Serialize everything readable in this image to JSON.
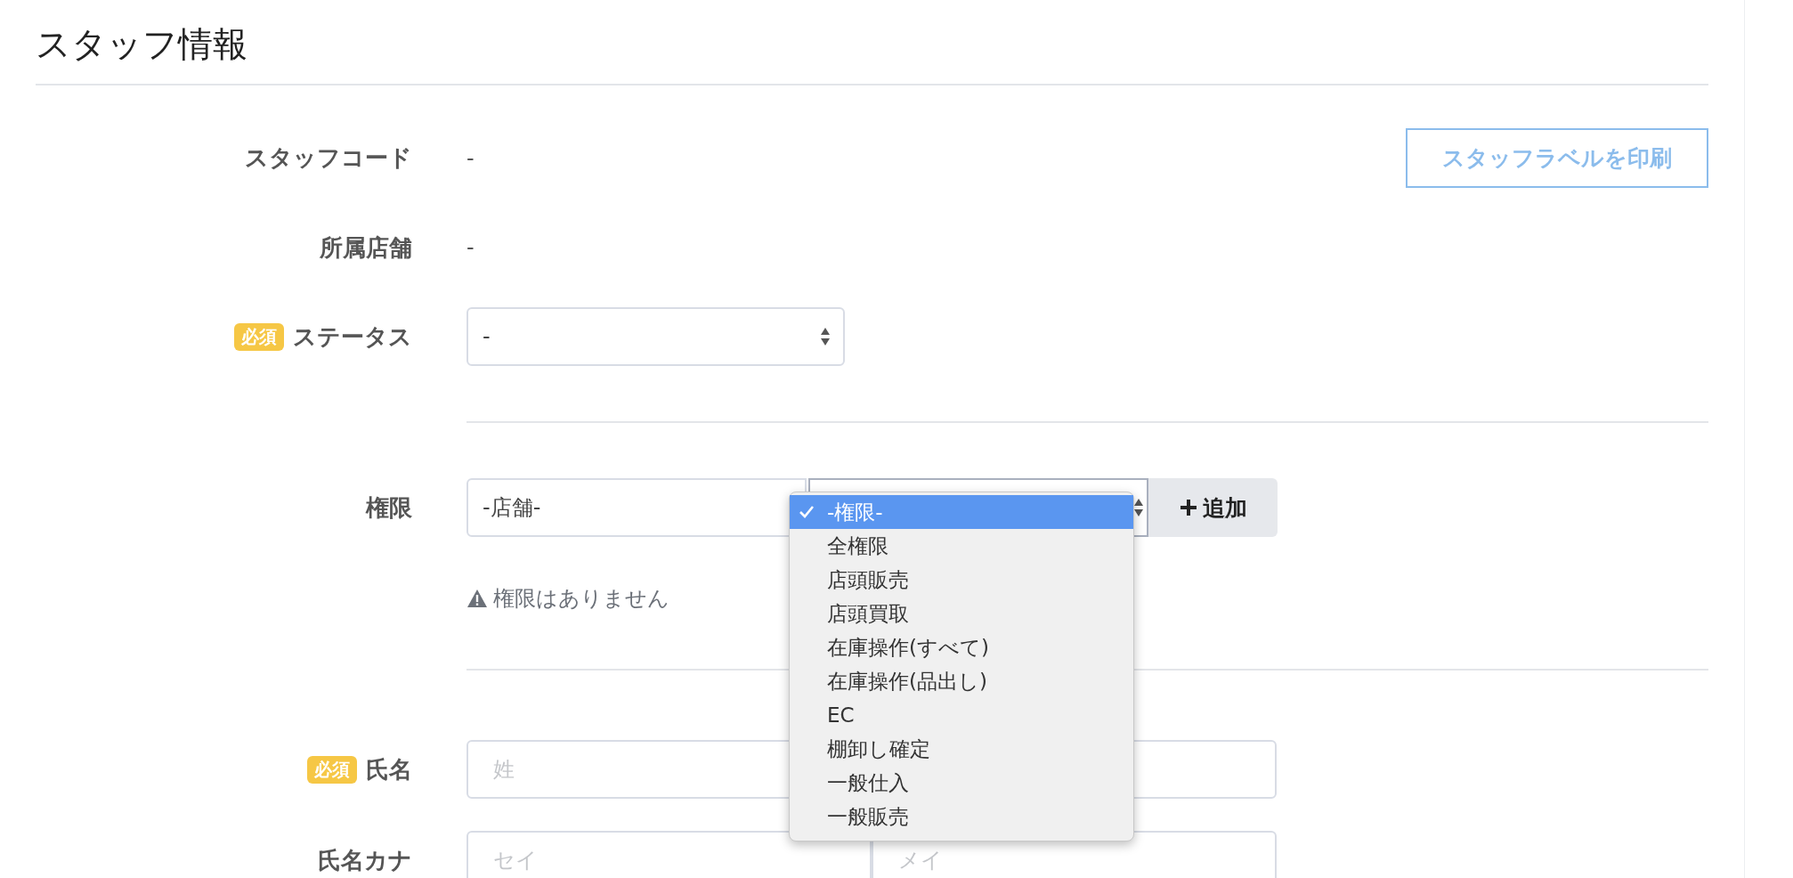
{
  "title": "スタッフ情報",
  "print_button": "スタッフラベルを印刷",
  "fields": [
    {
      "kind": "text",
      "label": "スタッフコード",
      "value": "-"
    },
    {
      "kind": "text",
      "label": "所属店舗",
      "value": "-"
    },
    {
      "kind": "select",
      "label": "ステータス",
      "badge": "必須",
      "value": "-"
    }
  ],
  "permission": {
    "label": "権限",
    "store_select": "-店舗-",
    "add_button": "追加",
    "warning": "権限はありません",
    "options": [
      {
        "label": "-権限-",
        "selected": true
      },
      {
        "label": "全権限",
        "selected": false
      },
      {
        "label": "店頭販売",
        "selected": false
      },
      {
        "label": "店頭買取",
        "selected": false
      },
      {
        "label": "在庫操作(すべて)",
        "selected": false
      },
      {
        "label": "在庫操作(品出し)",
        "selected": false
      },
      {
        "label": "EC",
        "selected": false
      },
      {
        "label": "棚卸し確定",
        "selected": false
      },
      {
        "label": "一般仕入",
        "selected": false
      },
      {
        "label": "一般販売",
        "selected": false
      }
    ]
  },
  "names": [
    {
      "label": "氏名",
      "badge": "必須",
      "placeholders": [
        "姓"
      ]
    },
    {
      "label": "氏名カナ",
      "placeholders": [
        "セイ",
        "メイ"
      ]
    }
  ]
}
